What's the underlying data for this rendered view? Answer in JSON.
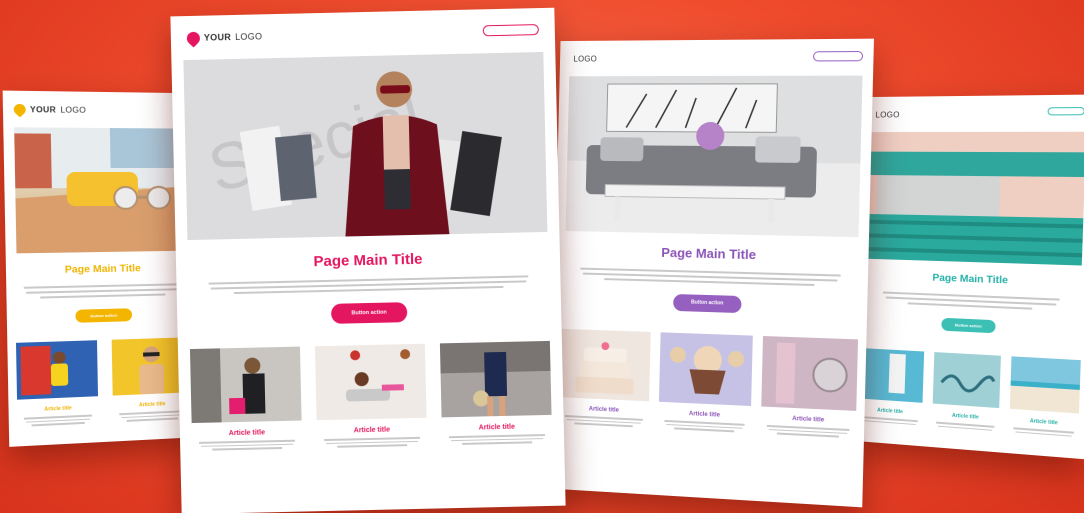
{
  "background": {
    "accent": "#ef4b2c"
  },
  "cards": {
    "pink": {
      "accent": "#e4165f",
      "logo_bold": "YOUR",
      "logo_rest": "LOGO",
      "header_button": "",
      "hero_watermark": "Special",
      "main_title": "Page Main Title",
      "cta": "Button action",
      "articles": [
        {
          "title": "Article title"
        },
        {
          "title": "Article title"
        },
        {
          "title": "Article title"
        }
      ]
    },
    "yellow": {
      "accent": "#f3b500",
      "logo_bold": "YOUR",
      "logo_rest": "LOGO",
      "main_title": "Page Main Title",
      "cta": "Button action",
      "articles": [
        {
          "title": "Article title"
        },
        {
          "title": "Article title"
        }
      ]
    },
    "purple": {
      "accent": "#9560c0",
      "logo_bold": "",
      "logo_rest": "LOGO",
      "header_button": "",
      "main_title": "Page Main Title",
      "cta": "Button action",
      "articles": [
        {
          "title": "Article title"
        },
        {
          "title": "Article title"
        },
        {
          "title": "Article title"
        }
      ]
    },
    "teal": {
      "accent": "#3cc0b6",
      "logo_bold": "",
      "logo_rest": "LOGO",
      "header_button": "",
      "main_title": "Page Main Title",
      "cta": "Button action",
      "articles": [
        {
          "title": "Article title"
        },
        {
          "title": "Article title"
        },
        {
          "title": "Article title"
        }
      ]
    }
  }
}
